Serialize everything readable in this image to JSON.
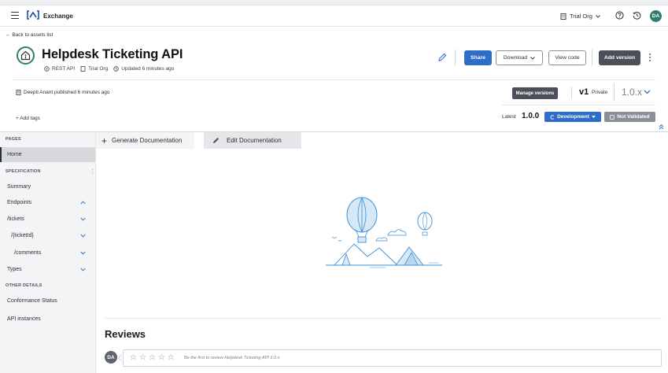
{
  "topbar": {
    "app_name": "Exchange",
    "org_name": "Trial Org",
    "avatar_initials": "DA"
  },
  "header": {
    "back_link": "Back to assets list",
    "title": "Helpdesk Ticketing API",
    "meta": {
      "type": "REST API",
      "org": "Trial Org",
      "updated": "Updated 6 minutes ago"
    },
    "buttons": {
      "share": "Share",
      "download": "Download",
      "view_code": "View code",
      "add_version": "Add version"
    },
    "publish_line": "Deepti Anant published 6 minutes ago",
    "manage_versions": "Manage versions",
    "version_major": "v1",
    "visibility": "Private",
    "version_selected": "1.0.x",
    "add_tags": "+ Add tags",
    "latest_label": "Latest",
    "latest_version": "1.0.0",
    "lifecycle_state": "Development",
    "validation_state": "Not Validated"
  },
  "sidebar": {
    "pages_heading": "PAGES",
    "home": "Home",
    "spec_heading": "SPECIFICATION",
    "items": [
      {
        "label": "Summary"
      },
      {
        "label": "Endpoints"
      },
      {
        "label": "/tickets"
      },
      {
        "label": "/{ticketId}"
      },
      {
        "label": "/comments"
      },
      {
        "label": "Types"
      }
    ],
    "other_heading": "OTHER DETAILS",
    "other_items": [
      {
        "label": "Conformance Status"
      },
      {
        "label": "API instances"
      }
    ]
  },
  "main": {
    "tab_generate": "Generate Documentation",
    "tab_edit": "Edit Documentation",
    "reviews_title": "Reviews",
    "reviewer_initials": "DA",
    "review_placeholder": "Be the first to review Helpdesk Ticketing API 1.0.x",
    "rating_max": 5
  },
  "colors": {
    "accent": "#2f6ec8",
    "brand_green": "#2f7d6d",
    "dark_button": "#4b4f57"
  }
}
